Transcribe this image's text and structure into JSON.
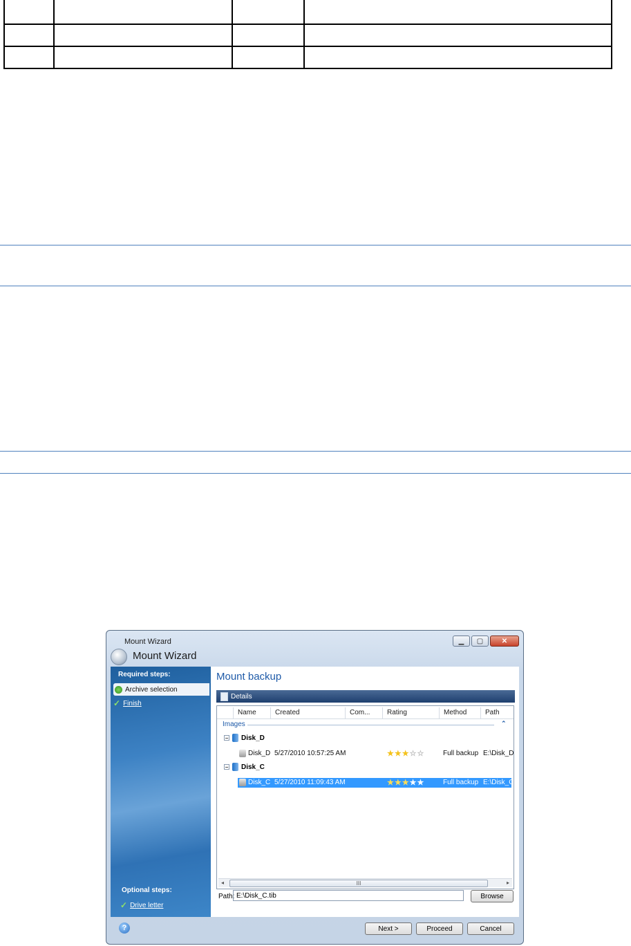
{
  "window": {
    "titlebar_text": "Mount Wizard",
    "title": "Mount Wizard",
    "minimize_glyph": "▁",
    "maximize_glyph": "▢",
    "close_glyph": "✕"
  },
  "sidebar": {
    "required_heading": "Required steps:",
    "optional_heading": "Optional steps:",
    "steps": [
      {
        "label": "Archive selection",
        "active": true
      },
      {
        "label": "Finish"
      }
    ],
    "optional_steps": [
      {
        "label": "Drive letter"
      }
    ]
  },
  "main": {
    "title": "Mount backup",
    "details_label": "Details",
    "columns": [
      "Name",
      "Created",
      "Com...",
      "Rating",
      "Method",
      "Path"
    ],
    "group_label": "Images",
    "disks": [
      {
        "name": "Disk_D",
        "backups": [
          {
            "name": "Disk_D",
            "created": "5/27/2010 10:57:25 AM",
            "rating": 3,
            "method": "Full backup",
            "path": "E:\\Disk_D",
            "selected": false
          }
        ]
      },
      {
        "name": "Disk_C",
        "backups": [
          {
            "name": "Disk_C",
            "created": "5/27/2010 11:09:43 AM",
            "rating": 5,
            "method": "Full backup",
            "path": "E:\\Disk_C",
            "selected": true
          }
        ]
      }
    ],
    "scroll_thumb_glyph": "III",
    "path_label": "Path:",
    "path_value": "E:\\Disk_C.tib",
    "browse_label": "Browse"
  },
  "footer": {
    "help_glyph": "?",
    "next_label": "Next >",
    "proceed_label": "Proceed",
    "cancel_label": "Cancel"
  },
  "colors": {
    "accent": "#1e5aa8",
    "selection": "#3399ff",
    "rule": "#4f81bd"
  }
}
